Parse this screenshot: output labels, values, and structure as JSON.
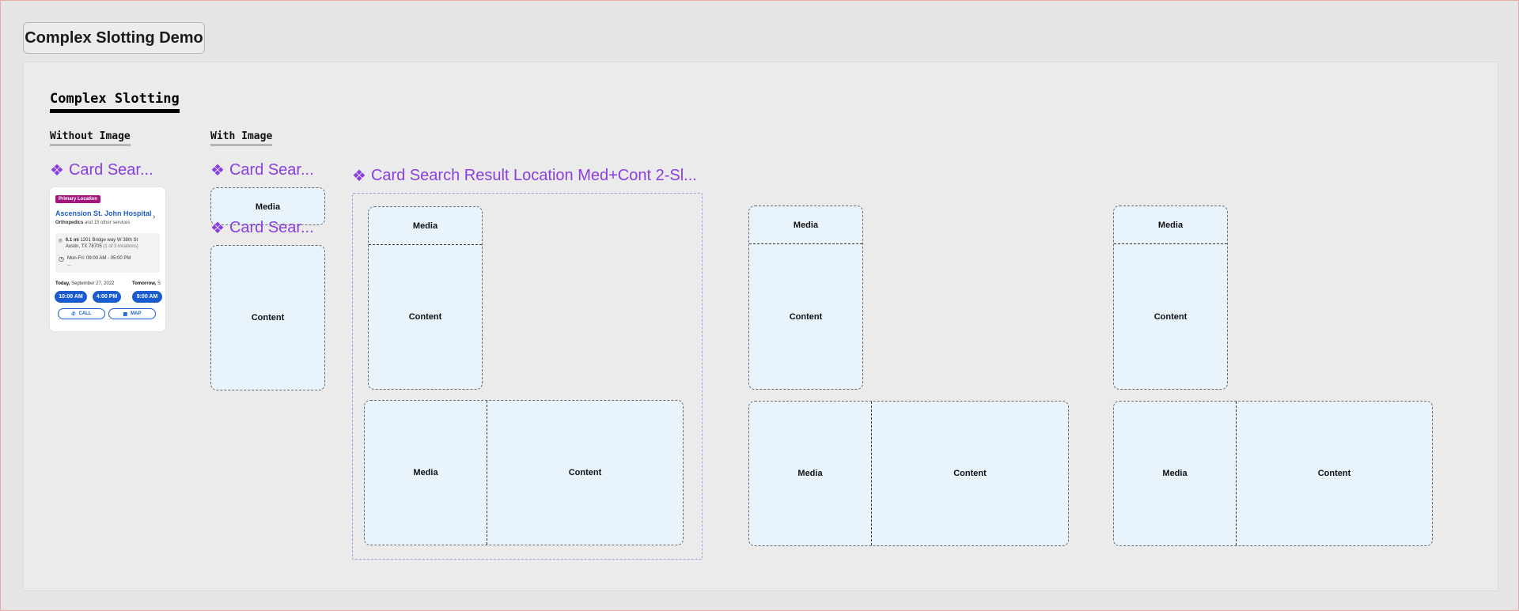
{
  "page": {
    "title": "Complex Slotting Demo",
    "section_title": "Complex Slotting",
    "without_image_label": "Without Image",
    "with_image_label": "With Image"
  },
  "components": {
    "card_short_1": "Card Sear...",
    "card_short_2": "Card Sear...",
    "card_short_3": "Card Sear...",
    "variant_label": "Card Search Result Location Med+Cont 2-Sl..."
  },
  "slots": {
    "media": "Media",
    "content": "Content"
  },
  "card": {
    "badge": "Primary Location",
    "name": "Ascension St. John Hospital",
    "specialty_main": "Orthopedics",
    "specialty_rest": " and 15 other services",
    "distance": "6.1 mi",
    "address_line1": "1201 Bridge way W 38th St",
    "address_line2": "Austin, TX 78705",
    "address_extra": " (1 of 3 locations)",
    "hours": "Mon-Fri: 09:00 AM - 05:00 PM",
    "hours_more": "...",
    "today_label": "Today,",
    "today_date": " September 27, 2022",
    "tomorrow_label": "Tomorrow,",
    "tomorrow_date": " S",
    "times": [
      "10:00 AM",
      "4:00 PM",
      "9:00 AM"
    ],
    "call_label": "CALL",
    "map_label": "MAP"
  },
  "colors": {
    "accent_purple": "#8a3ee0",
    "brand_blue": "#1a5ccf",
    "badge_magenta": "#a3157d",
    "slot_fill": "#e8f3fc"
  }
}
